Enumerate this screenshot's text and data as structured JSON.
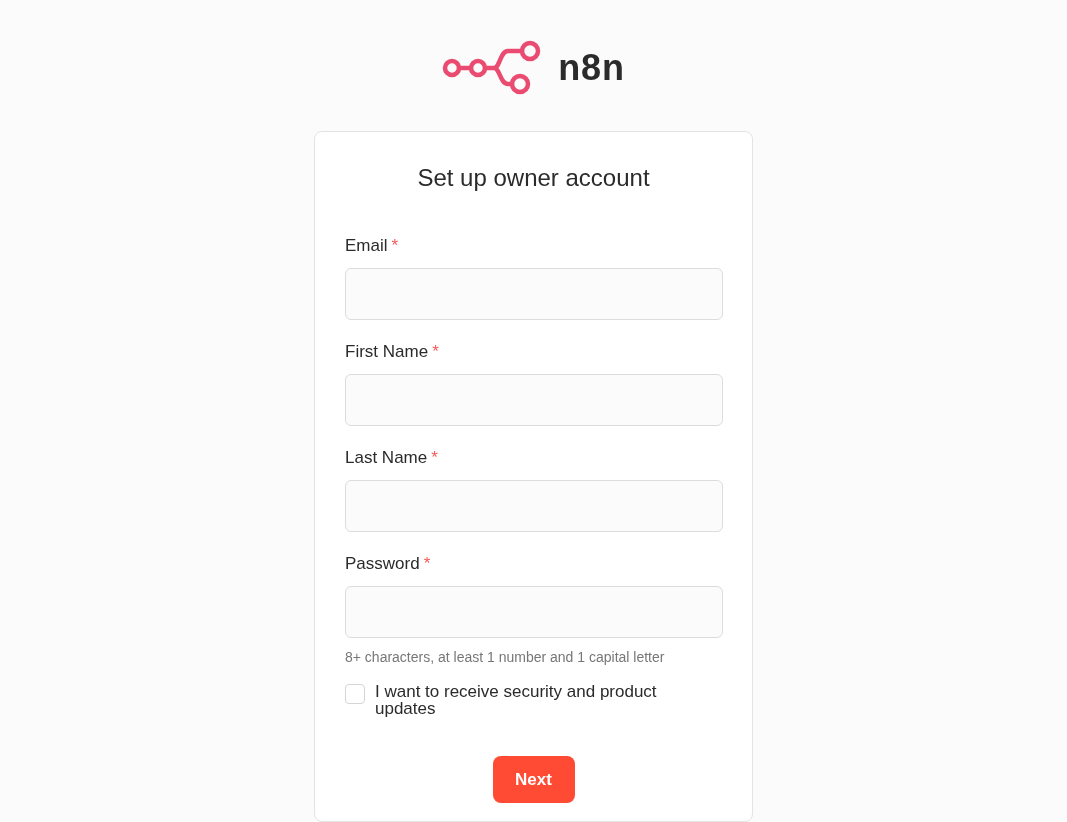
{
  "logo": {
    "wordmark": "n8n"
  },
  "card": {
    "title": "Set up owner account",
    "fields": [
      {
        "label": "Email",
        "required_mark": "*"
      },
      {
        "label": "First Name",
        "required_mark": "*"
      },
      {
        "label": "Last Name",
        "required_mark": "*"
      },
      {
        "label": "Password",
        "required_mark": "*",
        "hint": "8+ characters, at least 1 number and 1 capital letter"
      }
    ],
    "consent": {
      "label": "I want to receive security and product updates",
      "checked": false
    },
    "submit": {
      "label": "Next"
    }
  }
}
